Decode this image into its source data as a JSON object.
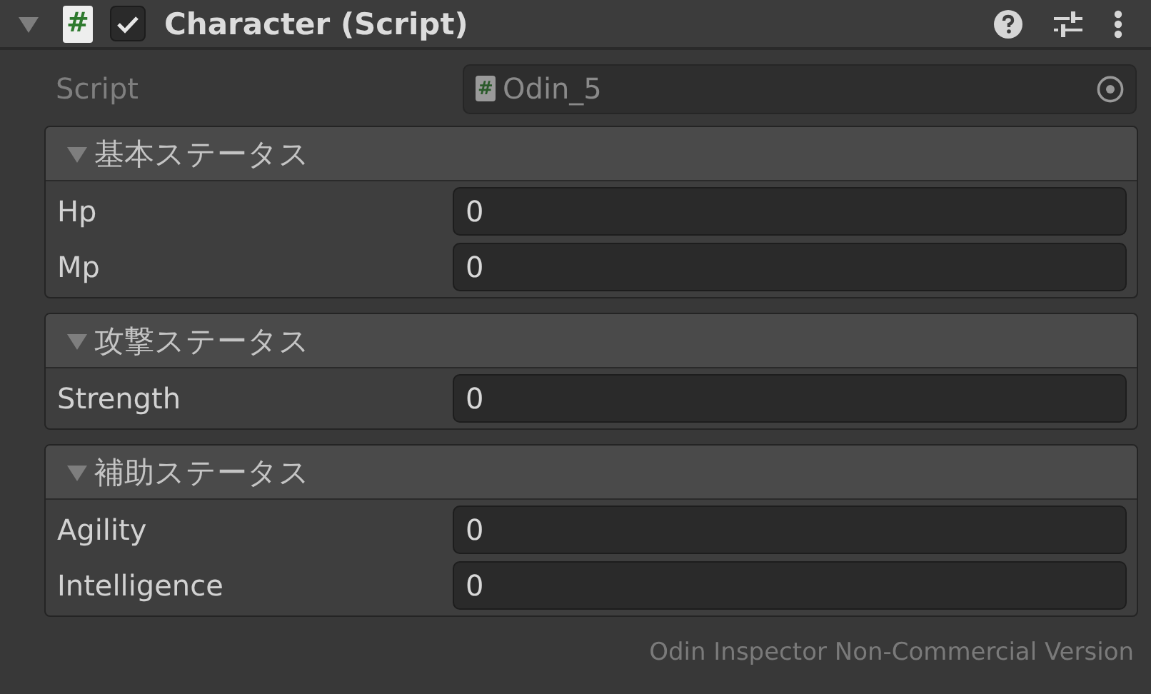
{
  "component": {
    "title": "Character (Script)",
    "expanded": true,
    "enabled": true,
    "icon_glyph": "#"
  },
  "script_field": {
    "label": "Script",
    "icon_glyph": "#",
    "value": "Odin_5"
  },
  "groups": [
    {
      "title": "基本ステータス",
      "expanded": true,
      "fields": [
        {
          "label": "Hp",
          "value": "0"
        },
        {
          "label": "Mp",
          "value": "0"
        }
      ]
    },
    {
      "title": "攻撃ステータス",
      "expanded": true,
      "fields": [
        {
          "label": "Strength",
          "value": "0"
        }
      ]
    },
    {
      "title": "補助ステータス",
      "expanded": true,
      "fields": [
        {
          "label": "Agility",
          "value": "0"
        },
        {
          "label": "Intelligence",
          "value": "0"
        }
      ]
    }
  ],
  "footer": "Odin Inspector Non-Commercial Version"
}
